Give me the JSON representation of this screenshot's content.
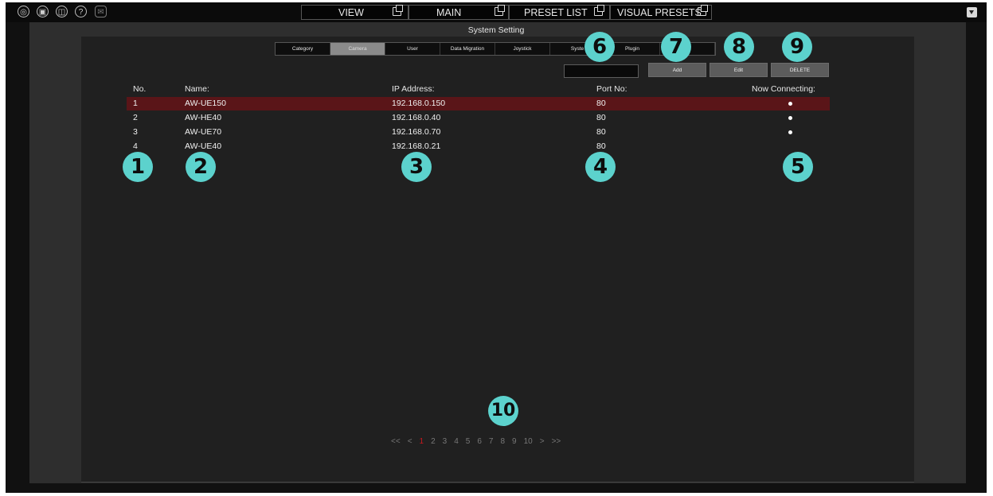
{
  "header": {
    "tabs": [
      {
        "label": "VIEW"
      },
      {
        "label": "MAIN"
      },
      {
        "label": "PRESET LIST"
      },
      {
        "label": "VISUAL PRESETS"
      }
    ],
    "icons": [
      "settings-icon",
      "camera-icon",
      "layout-icon",
      "help-icon",
      "chat-icon"
    ]
  },
  "window_title": "System Setting",
  "subtabs": [
    "Category",
    "Camera",
    "User",
    "Data Migration",
    "Joystick",
    "Syste",
    "Plugin",
    "ed"
  ],
  "active_subtab": "Camera",
  "toolbar": {
    "search_value": "",
    "add_label": "Add",
    "edit_label": "Edit",
    "delete_label": "DELETE"
  },
  "table": {
    "headers": [
      "No.",
      "Name:",
      "IP Address:",
      "Port No:",
      "Now Connecting:"
    ],
    "rows": [
      {
        "no": "1",
        "name": "AW-UE150",
        "ip": "192.168.0.150",
        "port": "80",
        "connecting": true,
        "selected": true
      },
      {
        "no": "2",
        "name": "AW-HE40",
        "ip": "192.168.0.40",
        "port": "80",
        "connecting": true,
        "selected": false
      },
      {
        "no": "3",
        "name": "AW-UE70",
        "ip": "192.168.0.70",
        "port": "80",
        "connecting": true,
        "selected": false
      },
      {
        "no": "4",
        "name": "AW-UE40",
        "ip": "192.168.0.21",
        "port": "80",
        "connecting": false,
        "selected": false
      }
    ]
  },
  "pagination": {
    "first": "<<",
    "prev": "<",
    "pages": [
      "1",
      "2",
      "3",
      "4",
      "5",
      "6",
      "7",
      "8",
      "9",
      "10"
    ],
    "current": "1",
    "next": ">",
    "last": ">>"
  },
  "callouts": [
    "1",
    "2",
    "3",
    "4",
    "5",
    "6",
    "7",
    "8",
    "9",
    "10"
  ],
  "colors": {
    "selected_row": "#5a1518",
    "callout": "#5cd2cd",
    "current_page": "#c9181e"
  }
}
